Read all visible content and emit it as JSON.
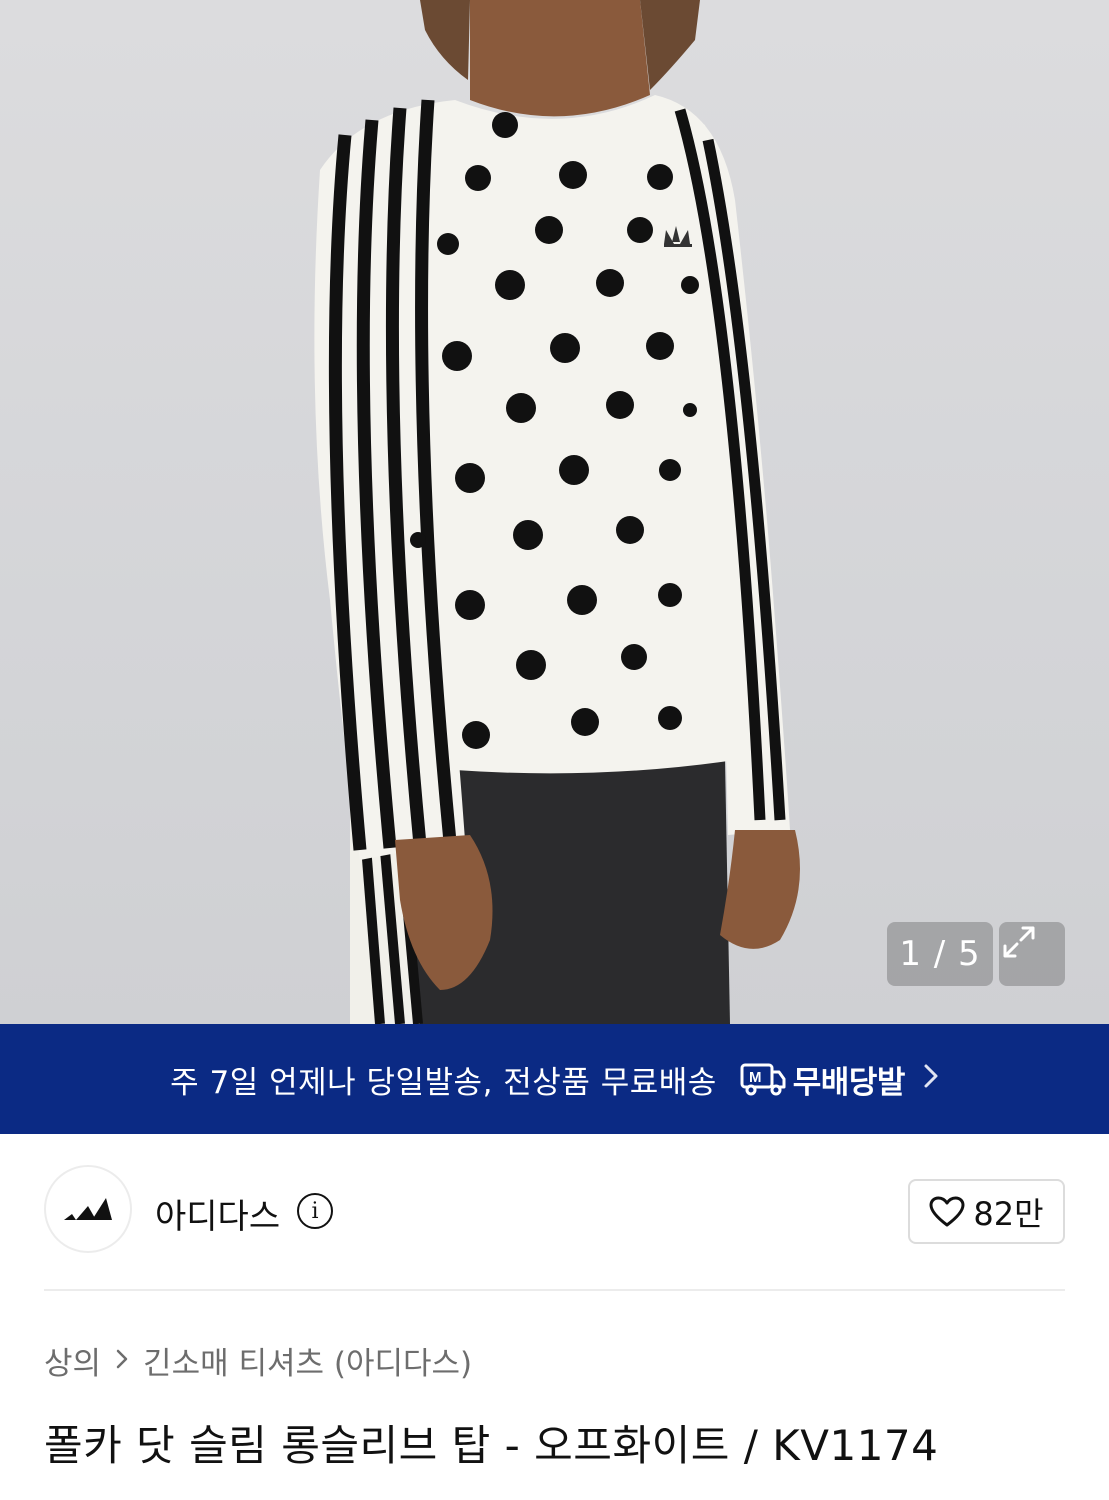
{
  "gallery": {
    "counter": "1 / 5",
    "current": 1,
    "total": 5,
    "expand_icon": "expand-arrows-icon"
  },
  "shipping_banner": {
    "text": "주 7일 언제나 당일발송, 전상품 무료배송",
    "brand": "무배당발",
    "logo_icon": "delivery-truck-m-icon",
    "chevron_icon": "chevron-right-icon",
    "background": "#0b2a84"
  },
  "brand": {
    "name": "아디다스",
    "logo_icon": "adidas-logo-icon",
    "info_icon": "info-icon",
    "likes": "82만",
    "heart_icon": "heart-outline-icon"
  },
  "breadcrumb": {
    "items": [
      "상의",
      "긴소매 티셔츠 (아디다스)"
    ]
  },
  "product": {
    "title": "폴카 닷 슬림 롱슬리브 탑 - 오프화이트 / KV1174"
  }
}
